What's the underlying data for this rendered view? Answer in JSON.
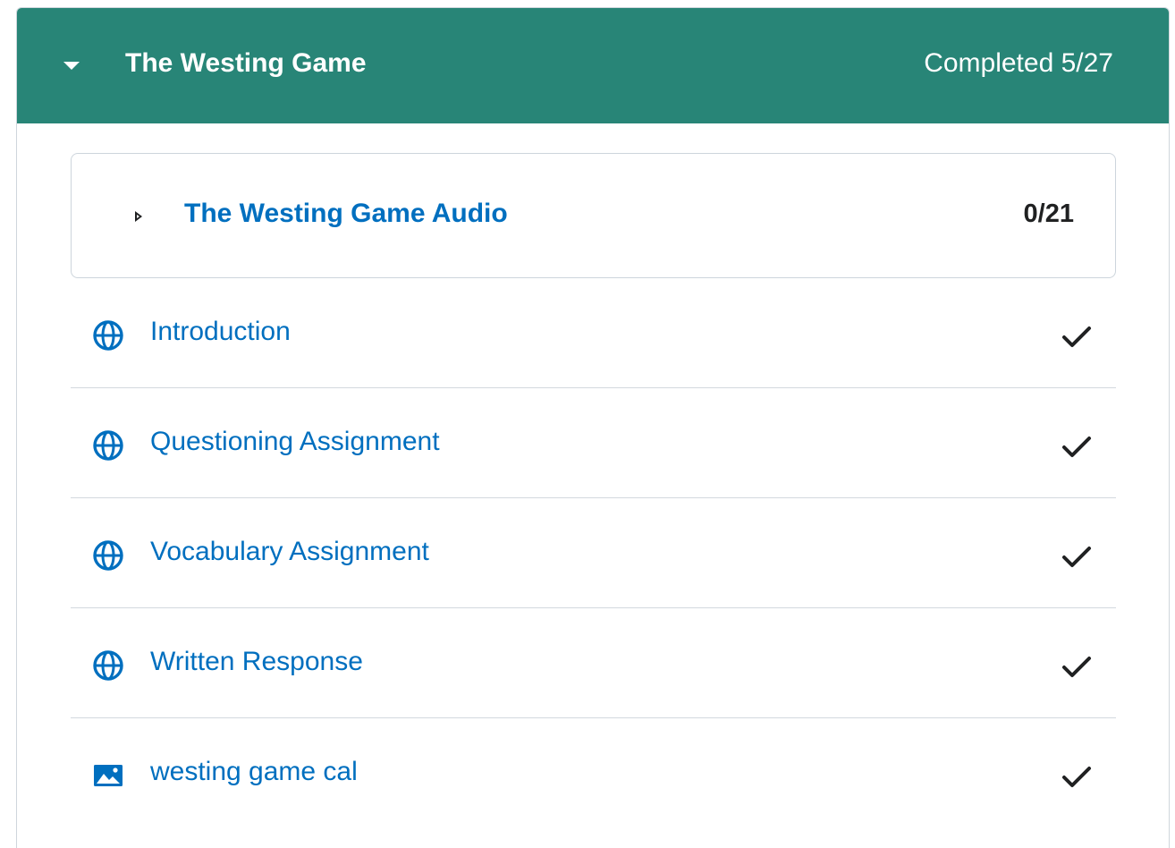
{
  "module": {
    "title": "The Westing Game",
    "progress": "Completed 5/27",
    "expanded": true,
    "header_color": "#288577",
    "submodule": {
      "title": "The Westing Game Audio",
      "count": "0/21",
      "expanded": false
    },
    "topics": [
      {
        "label": "Introduction",
        "icon": "globe-icon",
        "completed": true
      },
      {
        "label": "Questioning Assignment",
        "icon": "globe-icon",
        "completed": true
      },
      {
        "label": "Vocabulary Assignment",
        "icon": "globe-icon",
        "completed": true
      },
      {
        "label": "Written Response",
        "icon": "globe-icon",
        "completed": true
      },
      {
        "label": "westing game cal",
        "icon": "image-icon",
        "completed": true
      }
    ]
  },
  "colors": {
    "link": "#006fbf",
    "icon": "#006fbf",
    "check": "#202122"
  }
}
